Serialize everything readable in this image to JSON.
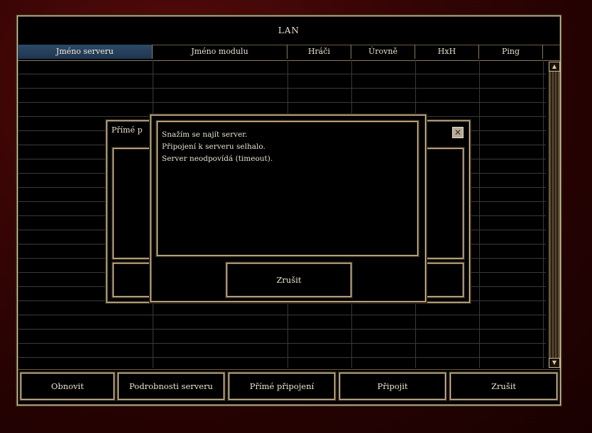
{
  "window": {
    "title": "LAN",
    "columns": [
      {
        "label": "Jméno serveru",
        "selected": true
      },
      {
        "label": "Jméno modulu"
      },
      {
        "label": "Hráči"
      },
      {
        "label": "Úrovně"
      },
      {
        "label": "HxH"
      },
      {
        "label": "Ping"
      }
    ],
    "buttons": {
      "refresh": "Obnovit",
      "server_details": "Podrobnosti serveru",
      "direct_connect": "Přímé připojení",
      "connect": "Připojit",
      "cancel": "Zrušit"
    }
  },
  "direct_dialog": {
    "title_fragment": "Přímé p"
  },
  "message_dialog": {
    "lines": [
      "Snažím se najít server.",
      "Připojení k serveru selhalo.",
      "Server neodpovídá (timeout)."
    ],
    "cancel_label": "Zrušit"
  },
  "colors": {
    "selected_header": "#2d4a66",
    "frame_gold": "#d9c9a8",
    "background_red": "#3a0505"
  }
}
